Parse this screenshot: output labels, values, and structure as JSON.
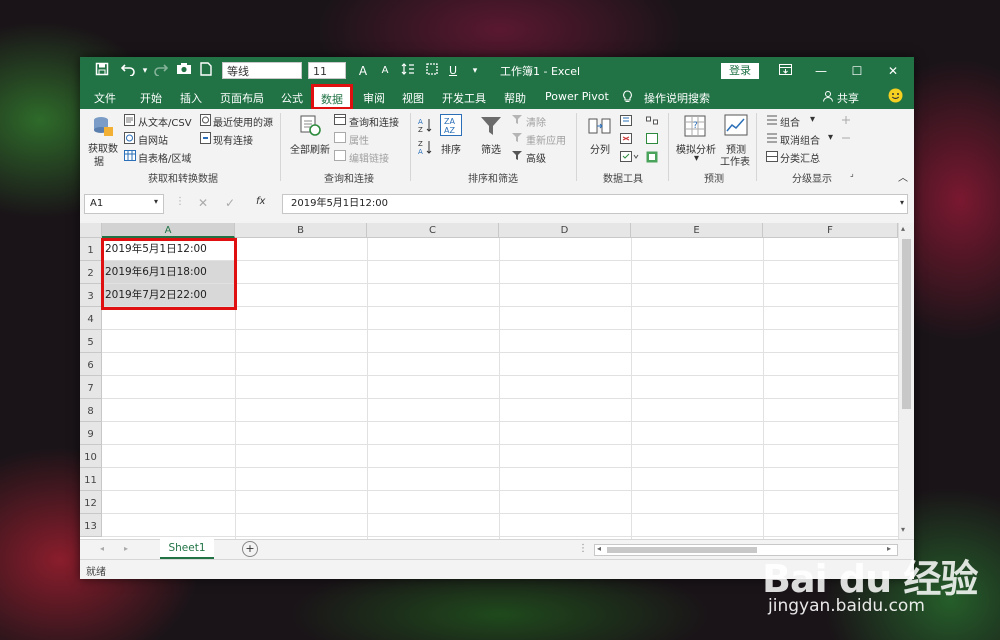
{
  "titlebar": {
    "font_name": "等线",
    "font_size": "11",
    "doc_title": "工作簿1 - Excel",
    "login": "登录",
    "qa_icons": [
      "save-icon",
      "undo-icon",
      "redo-icon",
      "camera-icon",
      "new-doc-icon"
    ],
    "font_icons": [
      "A",
      "A"
    ]
  },
  "menu": {
    "tabs": [
      "文件",
      "开始",
      "插入",
      "页面布局",
      "公式",
      "数据",
      "审阅",
      "视图",
      "开发工具",
      "帮助",
      "Power Pivot",
      "操作说明搜索"
    ],
    "active": "数据",
    "share": "共享"
  },
  "ribbon": {
    "get_data": {
      "main": "获取数",
      "main2": "据",
      "items": [
        "从文本/CSV",
        "自网站",
        "自表格/区域",
        "最近使用的源",
        "现有连接"
      ],
      "group": "获取和转换数据"
    },
    "queries": {
      "refresh": "全部刷新",
      "items": [
        "查询和连接",
        "属性",
        "编辑链接"
      ],
      "group": "查询和连接"
    },
    "sort": {
      "sort": "排序",
      "filter": "筛选",
      "items": [
        "清除",
        "重新应用",
        "高级"
      ],
      "group": "排序和筛选"
    },
    "tools": {
      "split": "分列",
      "group": "数据工具"
    },
    "forecast": {
      "whatif": "模拟分析",
      "sheet1": "预测",
      "sheet2": "工作表",
      "group": "预测"
    },
    "outline": {
      "items": [
        "组合",
        "取消组合",
        "分类汇总"
      ],
      "group": "分级显示"
    }
  },
  "formula": {
    "namebox": "A1",
    "fx": "fx",
    "value": "2019年5月1日12:00"
  },
  "grid": {
    "columns": [
      "A",
      "B",
      "C",
      "D",
      "E",
      "F"
    ],
    "rows": [
      "1",
      "2",
      "3",
      "4",
      "5",
      "6",
      "7",
      "8",
      "9",
      "10",
      "11",
      "12",
      "13"
    ],
    "cells": [
      "2019年5月1日12:00",
      "2019年6月1日18:00",
      "2019年7月2日22:00"
    ]
  },
  "sheets": {
    "tabs": [
      "Sheet1"
    ],
    "add": "+"
  },
  "status": {
    "text": "就绪"
  },
  "watermark": {
    "brand": "Bai du 经验",
    "url": "jingyan.baidu.com"
  },
  "colors": {
    "excel_green": "#217346",
    "highlight_red": "#e01010",
    "selected_cell": "#d8d8d8"
  }
}
